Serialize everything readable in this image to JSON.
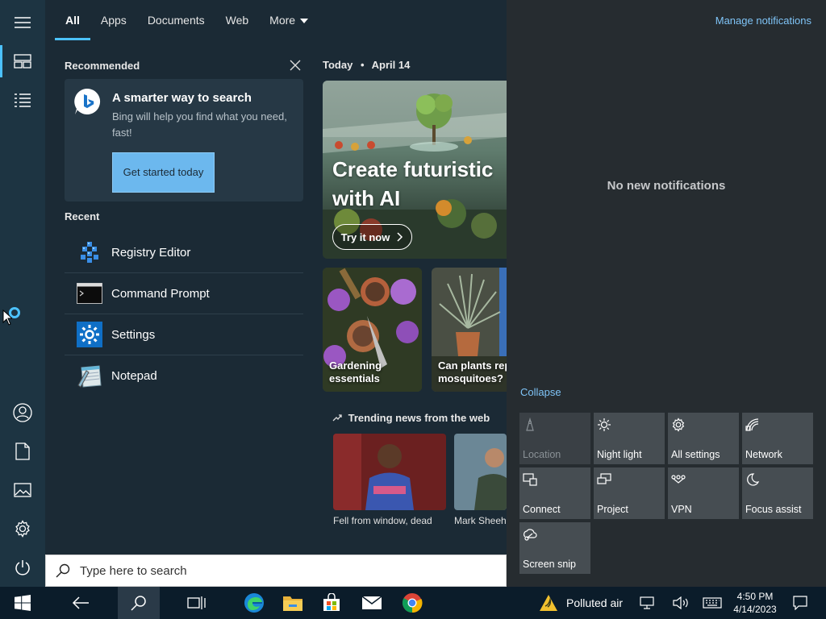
{
  "tabs": [
    {
      "label": "All",
      "active": true
    },
    {
      "label": "Apps"
    },
    {
      "label": "Documents"
    },
    {
      "label": "Web"
    },
    {
      "label": "More"
    }
  ],
  "recommended": {
    "title": "Recommended",
    "card_title": "A smarter way to search",
    "card_text": "Bing will help you find what you need, fast!",
    "button": "Get started today"
  },
  "recent": {
    "title": "Recent",
    "items": [
      {
        "label": "Registry Editor",
        "icon": "registry-editor-icon"
      },
      {
        "label": "Command Prompt",
        "icon": "command-prompt-icon"
      },
      {
        "label": "Settings",
        "icon": "settings-gear-icon"
      },
      {
        "label": "Notepad",
        "icon": "notepad-icon"
      }
    ]
  },
  "today": {
    "label": "Today",
    "separator": "•",
    "date": "April 14",
    "hero_title_line1": "Create futuristic",
    "hero_title_line2": "with AI",
    "hero_button": "Try it now",
    "tiles": [
      {
        "caption_line1": "Gardening",
        "caption_line2": "essentials"
      },
      {
        "caption_line1": "Can plants rep",
        "caption_line2": "mosquitoes?"
      }
    ],
    "trending_title": "Trending news from the web",
    "news": [
      {
        "caption": "Fell from window, dead"
      },
      {
        "caption": "Mark Sheeha"
      }
    ]
  },
  "search": {
    "placeholder": "Type here to search"
  },
  "action_center": {
    "manage": "Manage notifications",
    "empty": "No new notifications",
    "collapse": "Collapse",
    "quick_actions": [
      {
        "label": "Location",
        "icon": "location-icon",
        "disabled": true
      },
      {
        "label": "Night light",
        "icon": "night-light-icon"
      },
      {
        "label": "All settings",
        "icon": "settings-icon"
      },
      {
        "label": "Network",
        "icon": "network-icon"
      },
      {
        "label": "Connect",
        "icon": "connect-icon"
      },
      {
        "label": "Project",
        "icon": "project-icon"
      },
      {
        "label": "VPN",
        "icon": "vpn-icon"
      },
      {
        "label": "Focus assist",
        "icon": "focus-assist-icon"
      },
      {
        "label": "Screen snip",
        "icon": "screen-snip-icon"
      }
    ]
  },
  "taskbar": {
    "weather": "Polluted air",
    "time": "4:50 PM",
    "date": "4/14/2023"
  },
  "colors": {
    "accent": "#4cc2ff",
    "link": "#7fc4f7",
    "button": "#6cb8ee"
  }
}
